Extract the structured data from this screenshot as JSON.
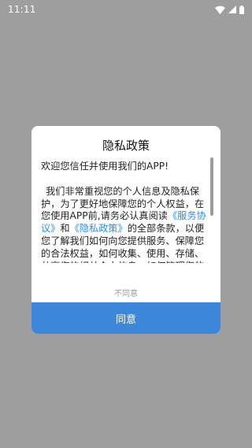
{
  "status_bar": {
    "time": "11:11",
    "icons": [
      "wifi-icon",
      "signal-icon",
      "battery-icon"
    ]
  },
  "dialog": {
    "title": "隐私政策",
    "greeting": "欢迎您信任并使用我们的APP!",
    "body_part1": "我们非常重视您的个人信息及隐私保护，为了更好地保障您的个人权益，在您使用APP前,请务必认真阅读",
    "link_service": "《服务协议》",
    "body_part2": "和",
    "link_privacy": "《隐私政策》",
    "body_part3": "的全部条款，以便您了解我们如何向您提供服务、保障您的合法权益，如何收集、使用、存储、共享您的相关个人信息，如何管理您的相关个人信息，以及我们对您提供的相",
    "disagree_label": "不同意",
    "agree_label": "同意"
  },
  "colors": {
    "overlay": "#9e9e9e",
    "link": "#2f8be6",
    "primary_button": "#3c87d9",
    "secondary_text": "#9a9a9a"
  }
}
